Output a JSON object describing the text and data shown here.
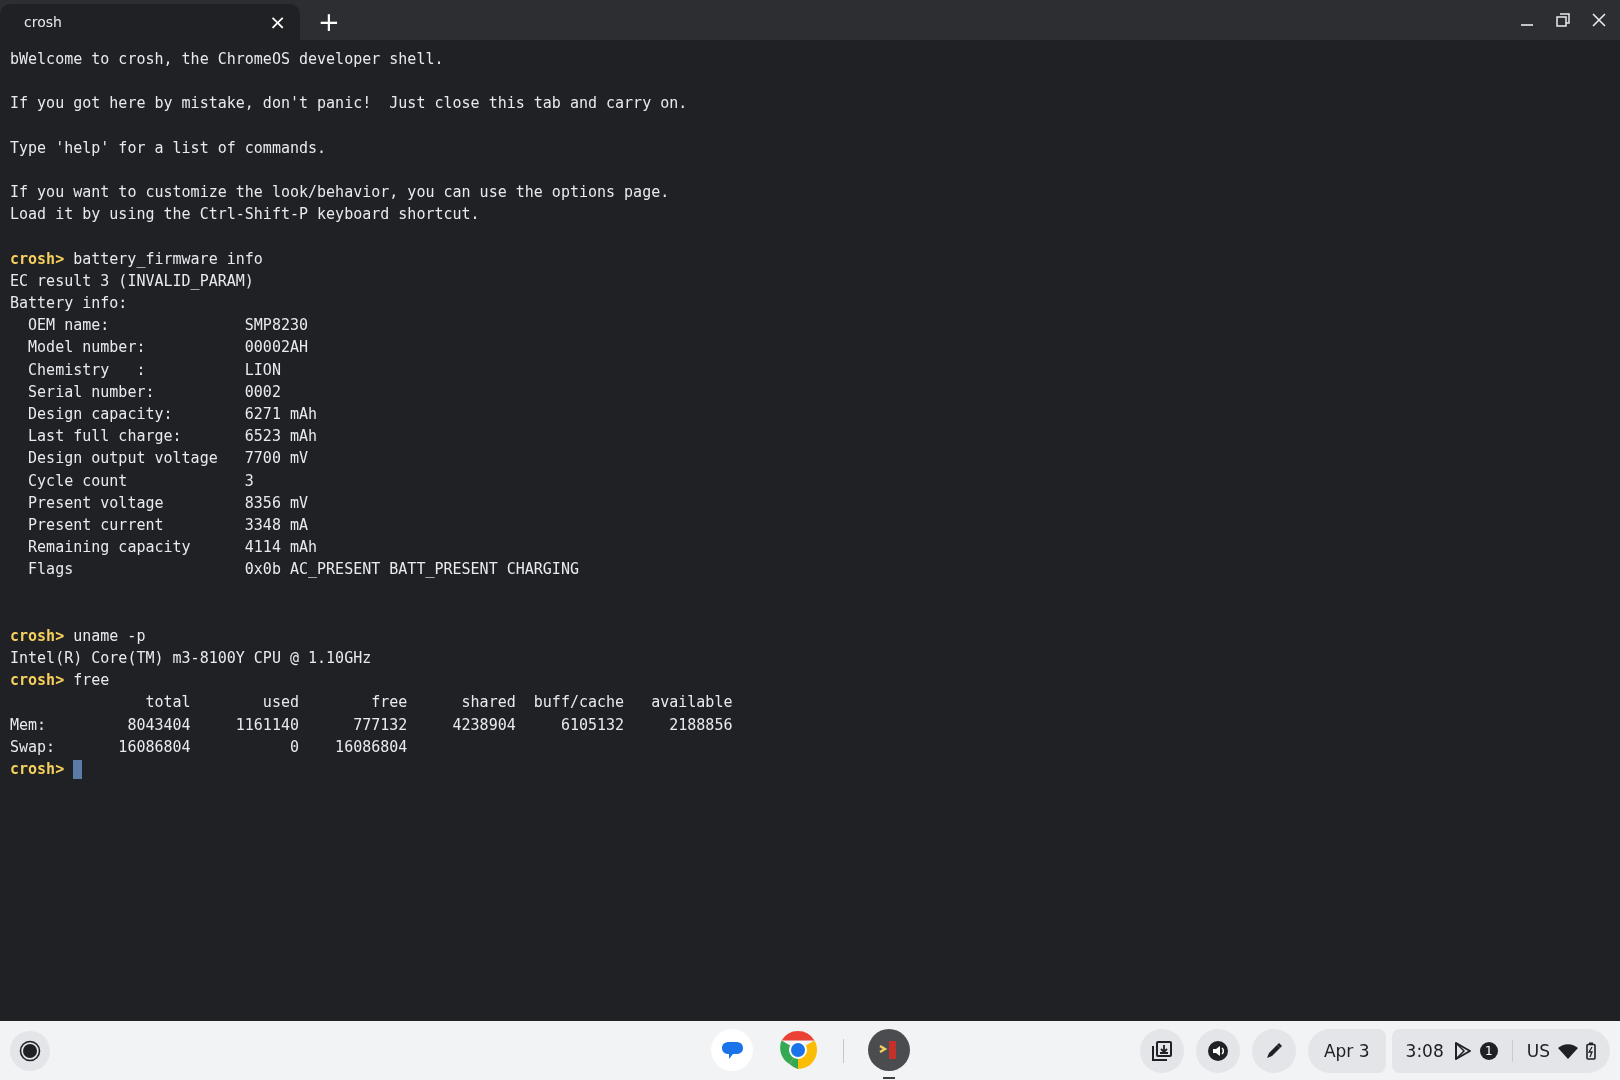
{
  "tabs": [
    {
      "label": "crosh",
      "close": "×",
      "selected": true
    }
  ],
  "new_tab": "+",
  "terminal": {
    "lines": [
      {
        "kind": "text",
        "text": "bWelcome to crosh, the ChromeOS developer shell."
      },
      {
        "kind": "blank"
      },
      {
        "kind": "text",
        "text": "If you got here by mistake, don't panic!  Just close this tab and carry on."
      },
      {
        "kind": "blank"
      },
      {
        "kind": "text",
        "text": "Type 'help' for a list of commands."
      },
      {
        "kind": "blank"
      },
      {
        "kind": "text",
        "text": "If you want to customize the look/behavior, you can use the options page."
      },
      {
        "kind": "text",
        "text": "Load it by using the Ctrl-Shift-P keyboard shortcut."
      },
      {
        "kind": "blank"
      },
      {
        "kind": "prompt",
        "prompt": "crosh>",
        "command": "battery_firmware info"
      },
      {
        "kind": "text",
        "text": "EC result 3 (INVALID_PARAM)"
      },
      {
        "kind": "text",
        "text": "Battery info:"
      },
      {
        "kind": "text",
        "text": "  OEM name:               SMP8230"
      },
      {
        "kind": "text",
        "text": "  Model number:           00002AH"
      },
      {
        "kind": "text",
        "text": "  Chemistry   :           LION"
      },
      {
        "kind": "text",
        "text": "  Serial number:          0002"
      },
      {
        "kind": "text",
        "text": "  Design capacity:        6271 mAh"
      },
      {
        "kind": "text",
        "text": "  Last full charge:       6523 mAh"
      },
      {
        "kind": "text",
        "text": "  Design output voltage   7700 mV"
      },
      {
        "kind": "text",
        "text": "  Cycle count             3"
      },
      {
        "kind": "text",
        "text": "  Present voltage         8356 mV"
      },
      {
        "kind": "text",
        "text": "  Present current         3348 mA"
      },
      {
        "kind": "text",
        "text": "  Remaining capacity      4114 mAh"
      },
      {
        "kind": "text",
        "text": "  Flags                   0x0b AC_PRESENT BATT_PRESENT CHARGING"
      },
      {
        "kind": "blank"
      },
      {
        "kind": "blank"
      },
      {
        "kind": "prompt",
        "prompt": "crosh>",
        "command": "uname -p"
      },
      {
        "kind": "text",
        "text": "Intel(R) Core(TM) m3-8100Y CPU @ 1.10GHz"
      },
      {
        "kind": "prompt",
        "prompt": "crosh>",
        "command": "free"
      },
      {
        "kind": "text",
        "text": "               total        used        free      shared  buff/cache   available"
      },
      {
        "kind": "text",
        "text": "Mem:         8043404     1161140      777132     4238904     6105132     2188856"
      },
      {
        "kind": "text",
        "text": "Swap:       16086804           0    16086804"
      },
      {
        "kind": "prompt",
        "prompt": "crosh>",
        "cursor": true
      }
    ]
  },
  "shelf": {
    "apps": [
      {
        "kind": "messages",
        "open": false
      },
      {
        "kind": "chrome",
        "open": false
      },
      {
        "kind": "terminal",
        "open": true
      }
    ],
    "date": "Apr 3",
    "time": "3:08",
    "notification_count": "1",
    "keyboard": "US"
  }
}
